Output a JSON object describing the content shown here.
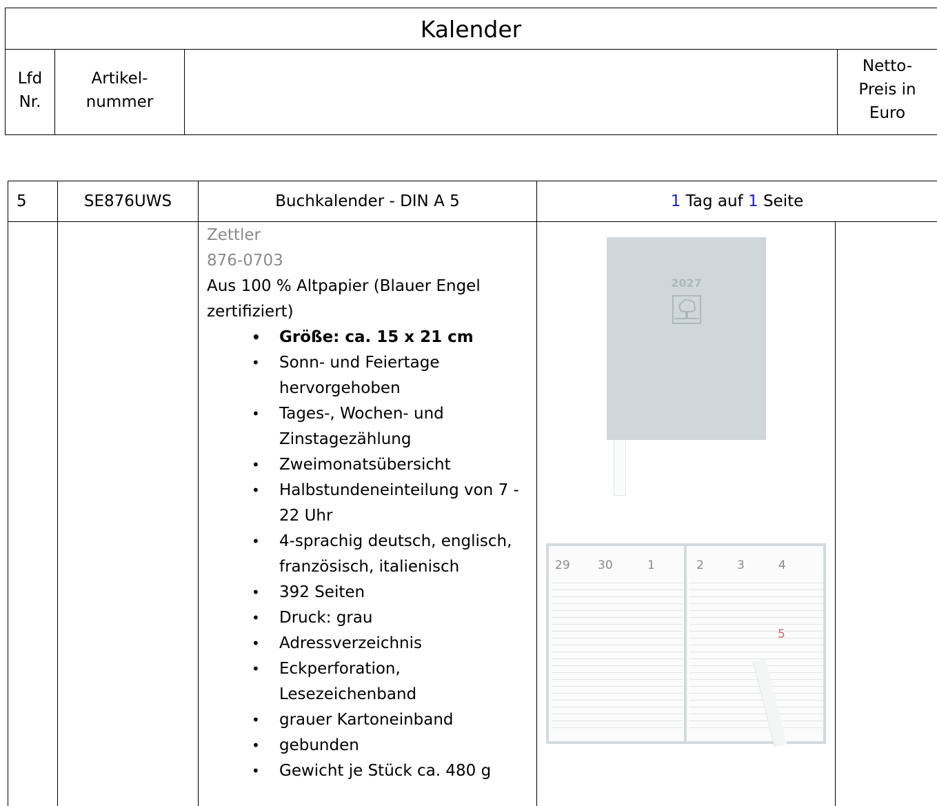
{
  "header": {
    "title": "Kalender",
    "col_lfd": [
      "Lfd",
      "Nr."
    ],
    "col_artikel": [
      "Artikel-",
      "nummer"
    ],
    "col_preis": [
      "Netto-",
      "Preis in",
      "Euro"
    ]
  },
  "product": {
    "lfd": "5",
    "artikelnummer": "SE876UWS",
    "name": "Buchkalender - DIN A 5",
    "format": {
      "n1": "1",
      "t1": " Tag auf ",
      "n2": "1",
      "t2": " Seite"
    },
    "brand": "Zettler",
    "model": "876-0703",
    "material": "Aus 100 % Altpapier (Blauer Engel zertifiziert)",
    "features": [
      "Größe: ca. 15 x 21 cm",
      "Sonn- und Feiertage hervorgehoben",
      "Tages-, Wochen- und Zinstagezählung",
      "Zweimonatsübersicht",
      "Halbstundeneinteilung von 7 - 22 Uhr",
      "4-sprachig deutsch, englisch, französisch, italienisch",
      "392 Seiten",
      "Druck: grau",
      "Adressverzeichnis",
      "Eckperforation, Lesezeichenband",
      "grauer Kartoneinband",
      "gebunden",
      "Gewicht je Stück ca. 480 g"
    ],
    "cover_year": "2027",
    "spread_days": [
      "29",
      "30",
      "1",
      "2",
      "3",
      "4",
      "5"
    ]
  },
  "colors": {
    "accent_number": "#1a22d6",
    "muted_text": "#8a8a8a",
    "cover": "#cfd7da"
  }
}
